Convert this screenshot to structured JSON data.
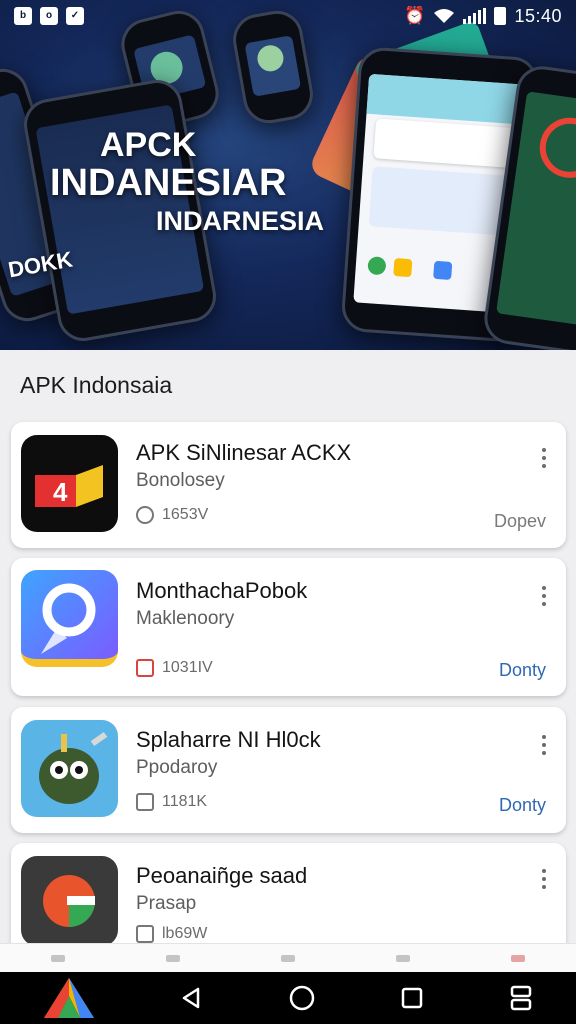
{
  "status_bar": {
    "time": "15:40",
    "left_icons": [
      "b-icon",
      "o-icon",
      "check-icon"
    ]
  },
  "hero": {
    "title_line1": "APCK",
    "title_line2": "INDANESIAR",
    "title_line3": "INDARNESIA",
    "phone_left_text": "DOKK"
  },
  "section": {
    "title": "APK Indonsaia"
  },
  "apps": [
    {
      "name": "APK SiNlinesar ACKX",
      "category": "Bonolosey",
      "size": "1653V",
      "action": "Dopev",
      "action_style": "muted",
      "icon": "red-video-app-icon"
    },
    {
      "name": "MonthachaPobok",
      "category": "Maklenoory",
      "size": "1031IV",
      "action": "Donty",
      "action_style": "blue",
      "icon": "blue-location-app-icon"
    },
    {
      "name": "Splaharre NI Hl0ck",
      "category": "Ppodaroy",
      "size": "1181K",
      "action": "Donty",
      "action_style": "blue",
      "icon": "robot-cartoon-app-icon"
    },
    {
      "name": "Peoanaiñge saad",
      "category": "Prasap",
      "size": "lb69W",
      "action": "",
      "action_style": "muted",
      "icon": "g-logo-app-icon"
    }
  ],
  "colors": {
    "accent_blue": "#2f69b3",
    "hero_bg": "#14285a",
    "red_icon": "#d9443e"
  }
}
